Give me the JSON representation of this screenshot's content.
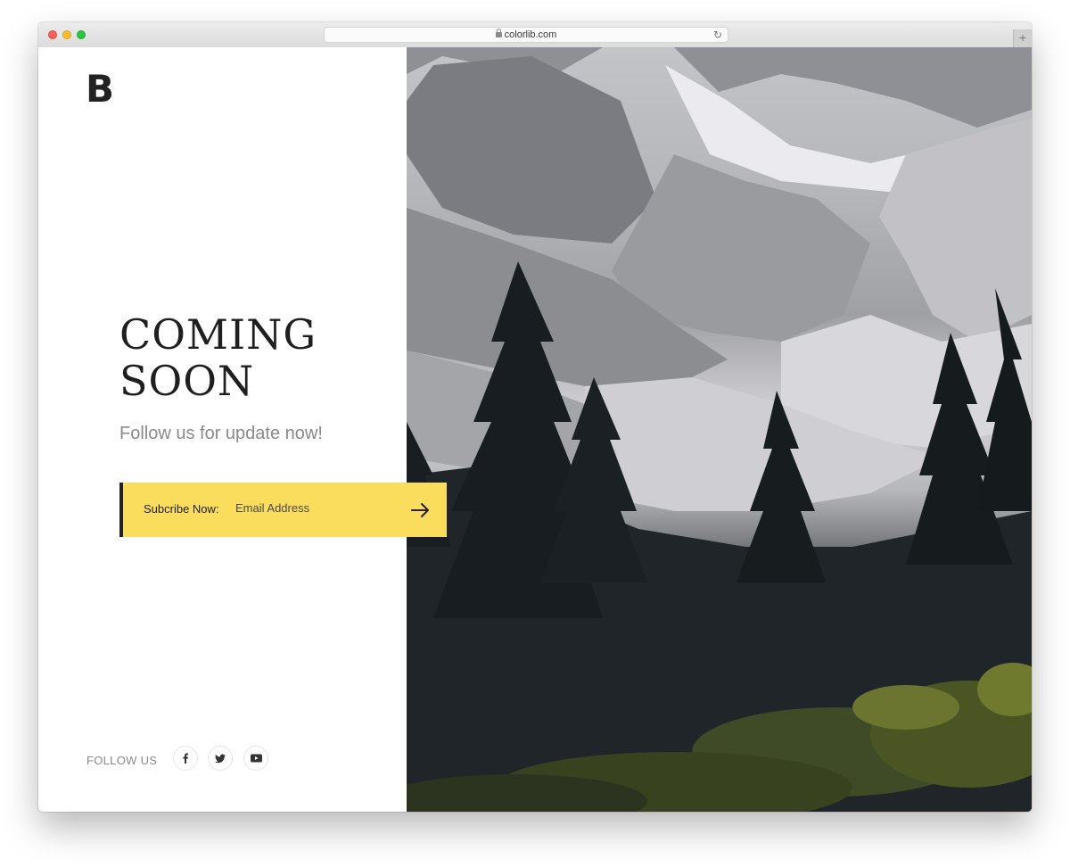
{
  "browser": {
    "url": "colorlib.com",
    "new_tab_label": "+"
  },
  "page": {
    "logo": "B",
    "headline_line1": "COMING",
    "headline_line2": "SOON",
    "tagline": "Follow us for update now!",
    "subscribe": {
      "label": "Subcribe Now:",
      "email_placeholder": "Email Address"
    },
    "follow_label": "FOLLOW US",
    "social": [
      "facebook-icon",
      "twitter-icon",
      "youtube-icon"
    ]
  },
  "colors": {
    "accent": "#fbdd5e",
    "text_dark": "#222222",
    "text_muted": "#8a8a8a"
  }
}
